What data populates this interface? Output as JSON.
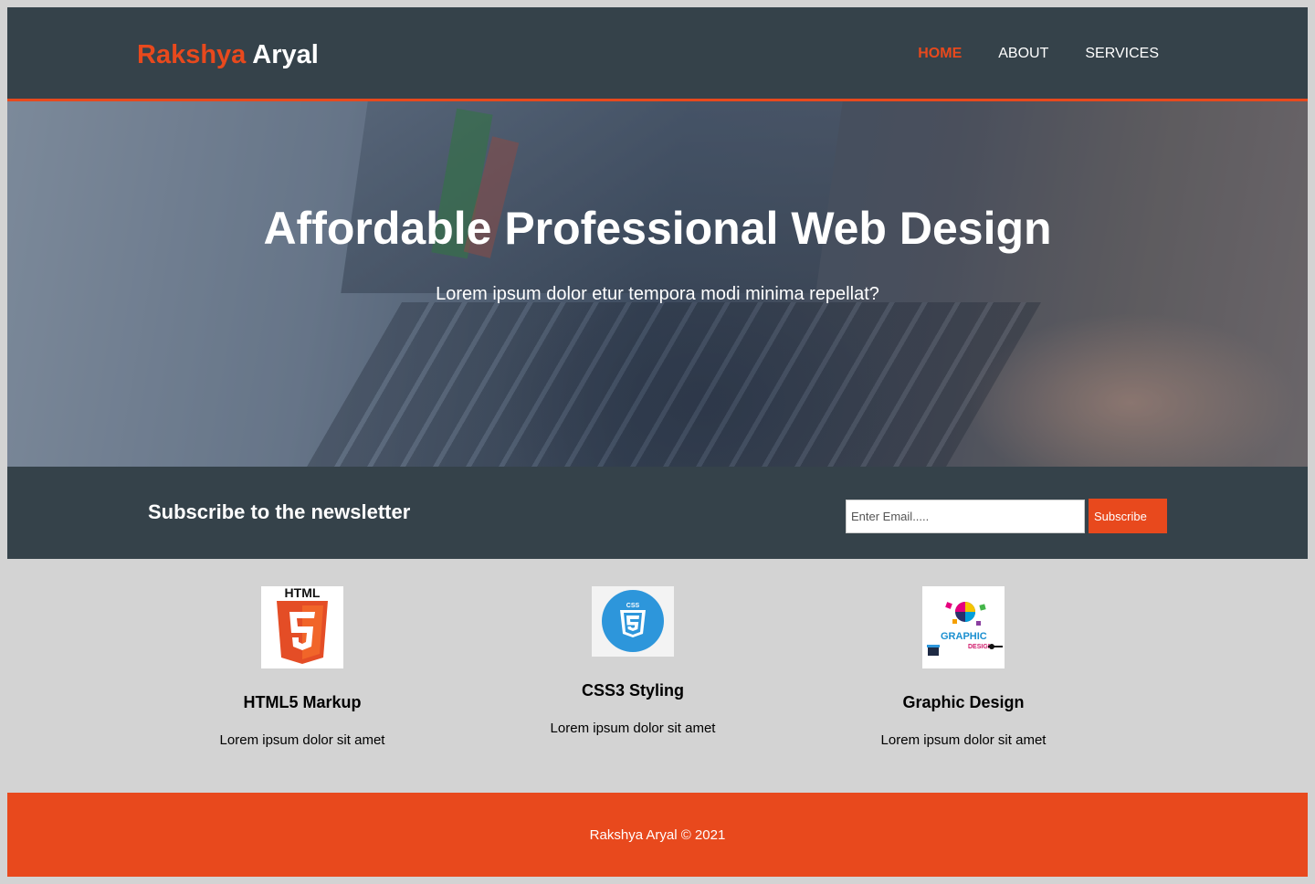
{
  "header": {
    "logo_highlight": "Rakshya",
    "logo_rest": "Aryal",
    "nav": [
      {
        "label": "HOME",
        "active": true
      },
      {
        "label": "ABOUT",
        "active": false
      },
      {
        "label": "SERVICES",
        "active": false
      }
    ]
  },
  "showcase": {
    "title": "Affordable Professional Web Design",
    "subtitle": "Lorem ipsum dolor etur tempora modi minima repellat?"
  },
  "newsletter": {
    "heading": "Subscribe to the newsletter",
    "email_placeholder": "Enter Email.....",
    "button_label": "Subscribe"
  },
  "boxes": [
    {
      "icon": "html5-logo-icon",
      "title": "HTML5 Markup",
      "text": "Lorem ipsum dolor sit amet"
    },
    {
      "icon": "css3-logo-icon",
      "title": "CSS3 Styling",
      "text": "Lorem ipsum dolor sit amet"
    },
    {
      "icon": "graphic-design-logo-icon",
      "title": "Graphic Design",
      "text": "Lorem ipsum dolor sit amet",
      "logo_text": [
        "GRAPHIC",
        "DESIGN"
      ]
    }
  ],
  "footer": {
    "text": "Rakshya Aryal © 2021"
  },
  "colors": {
    "accent": "#e8491d",
    "dark": "#35424a",
    "background": "#d3d3d3"
  }
}
